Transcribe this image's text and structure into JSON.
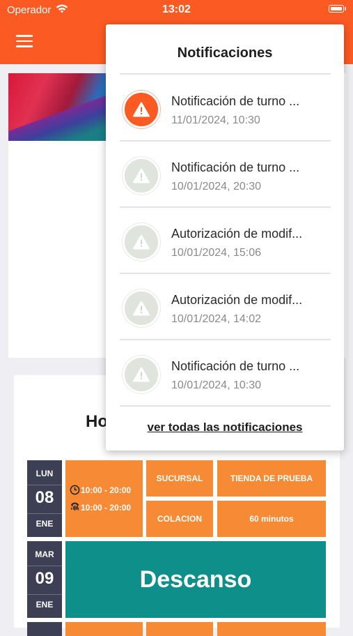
{
  "status_bar": {
    "carrier": "Operador",
    "time": "13:02"
  },
  "header": {
    "menu_icon": "hamburger-menu-icon",
    "accent": "#fb5a22"
  },
  "schedule": {
    "title_visible": "Ho",
    "days": [
      {
        "weekday": "LUN",
        "day": "08",
        "month": "ENE",
        "times": [
          "10:00 - 20:00",
          "10:00 - 20:00"
        ],
        "sucursal_label": "SUCURSAL",
        "sucursal_value": "TIENDA DE PRUEBA",
        "colacion_label": "COLACION",
        "colacion_value": "60 minutos"
      },
      {
        "weekday": "MAR",
        "day": "09",
        "month": "ENE",
        "status": "Descanso"
      }
    ]
  },
  "notifications": {
    "title": "Notificaciones",
    "items": [
      {
        "title": "Notificación de turno ...",
        "date": "11/01/2024, 10:30",
        "icon": "warning-icon",
        "unread": true
      },
      {
        "title": "Notificación de turno ...",
        "date": "10/01/2024, 20:30",
        "icon": "warning-icon",
        "unread": false
      },
      {
        "title": "Autorización de modif...",
        "date": "10/01/2024, 15:06",
        "icon": "warning-icon",
        "unread": false
      },
      {
        "title": "Autorización de modif...",
        "date": "10/01/2024, 14:02",
        "icon": "warning-icon",
        "unread": false
      },
      {
        "title": "Notificación de turno ...",
        "date": "10/01/2024, 10:30",
        "icon": "warning-icon",
        "unread": false
      }
    ],
    "see_all": "ver todas las notificaciones"
  },
  "colors": {
    "orange": "#f68a35",
    "teal": "#0e8f8a",
    "day_box": "#3d3f55"
  }
}
